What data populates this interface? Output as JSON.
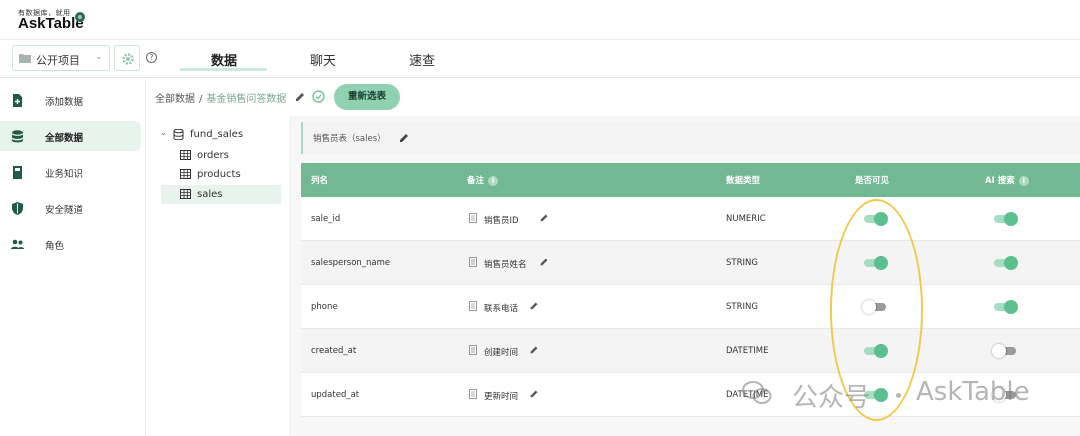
{
  "app": {
    "tagline": "有数据库，就用",
    "name": "AskTable"
  },
  "toolbar": {
    "project_select": "公开项目",
    "help": "?",
    "tabs": [
      {
        "label": "数据"
      },
      {
        "label": "聊天"
      },
      {
        "label": "速查"
      }
    ]
  },
  "sidebar": {
    "items": [
      {
        "label": "添加数据",
        "icon": "add-file-icon"
      },
      {
        "label": "全部数据",
        "icon": "database-icon"
      },
      {
        "label": "业务知识",
        "icon": "book-icon"
      },
      {
        "label": "安全隧道",
        "icon": "shield-icon"
      },
      {
        "label": "角色",
        "icon": "people-icon"
      }
    ]
  },
  "breadcrumb": {
    "root": "全部数据",
    "sep": "/",
    "current": "基金销售问答数据",
    "reselect": "重新选表"
  },
  "tree": {
    "schema": "fund_sales",
    "tables": [
      "orders",
      "products",
      "sales"
    ]
  },
  "table": {
    "title": "销售员表（sales）",
    "headers": {
      "col": "列名",
      "note": "备注",
      "type": "数据类型",
      "visible": "是否可见",
      "ai": "AI 搜索",
      "info": "i"
    },
    "rows": [
      {
        "col": "sale_id",
        "note": "销售员ID",
        "type": "NUMERIC",
        "visible": true,
        "ai": true
      },
      {
        "col": "salesperson_name",
        "note": "销售员姓名",
        "type": "STRING",
        "visible": true,
        "ai": true
      },
      {
        "col": "phone",
        "note": "联系电话",
        "type": "STRING",
        "visible": false,
        "ai": true
      },
      {
        "col": "created_at",
        "note": "创建时间",
        "type": "DATETIME",
        "visible": true,
        "ai": false
      },
      {
        "col": "updated_at",
        "note": "更新时间",
        "type": "DATETIME",
        "visible": true,
        "ai": false
      }
    ]
  },
  "watermark": {
    "text": "公众号",
    "brand": "AskTable"
  },
  "colors": {
    "accent": "#72b892",
    "toggle_on": "#5cbf8e",
    "highlight": "#f2c94c"
  }
}
